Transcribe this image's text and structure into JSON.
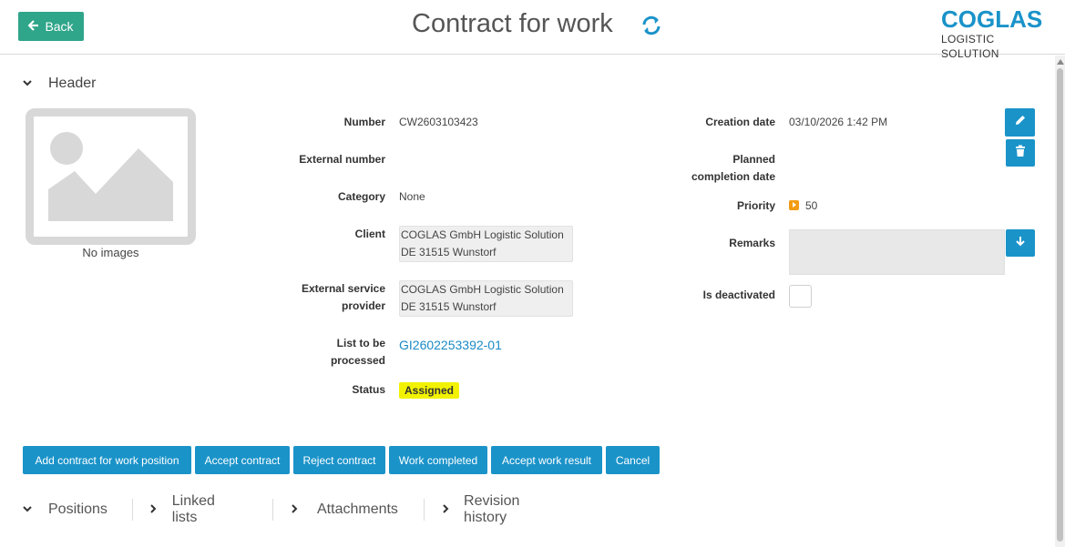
{
  "header_bar": {
    "back_label": "Back",
    "title": "Contract for work",
    "logo_main": "COGLAS",
    "logo_sub": "LOGISTIC SOLUTION"
  },
  "header_section": {
    "label": "Header",
    "no_images": "No images"
  },
  "fields": {
    "number_label": "Number",
    "number_value": "CW2603103423",
    "external_number_label": "External number",
    "category_label": "Category",
    "category_value": "None",
    "client_label": "Client",
    "client_line1": "COGLAS GmbH Logistic Solution",
    "client_line2": "DE 31515 Wunstorf",
    "esp_label_1": "External service",
    "esp_label_2": "provider",
    "esp_line1": "COGLAS GmbH Logistic Solution",
    "esp_line2": "DE 31515 Wunstorf",
    "list_label_1": "List to be",
    "list_label_2": "processed",
    "list_value": "GI2602253392-01",
    "status_label": "Status",
    "status_value": "Assigned",
    "creation_date_label": "Creation date",
    "creation_date_value": "03/10/2026 1:42 PM",
    "planned_label_1": "Planned",
    "planned_label_2": "completion date",
    "priority_label": "Priority",
    "priority_value": "50",
    "remarks_label": "Remarks",
    "deactivated_label": "Is deactivated"
  },
  "actions": [
    "Add contract for work position",
    "Accept contract",
    "Reject contract",
    "Work completed",
    "Accept work result",
    "Cancel"
  ],
  "tabs": [
    {
      "label": "Positions",
      "chevron": "chevron-down-icon"
    },
    {
      "label": "Linked lists",
      "chevron": "chevron-right-icon"
    },
    {
      "label": "Attachments",
      "chevron": "chevron-right-icon"
    },
    {
      "label": "Revision history",
      "chevron": "chevron-right-icon"
    }
  ],
  "colors": {
    "primary": "#1a93c9",
    "back_button": "#2fa58a",
    "status_badge": "#f2f200",
    "priority": "#f39c12"
  }
}
